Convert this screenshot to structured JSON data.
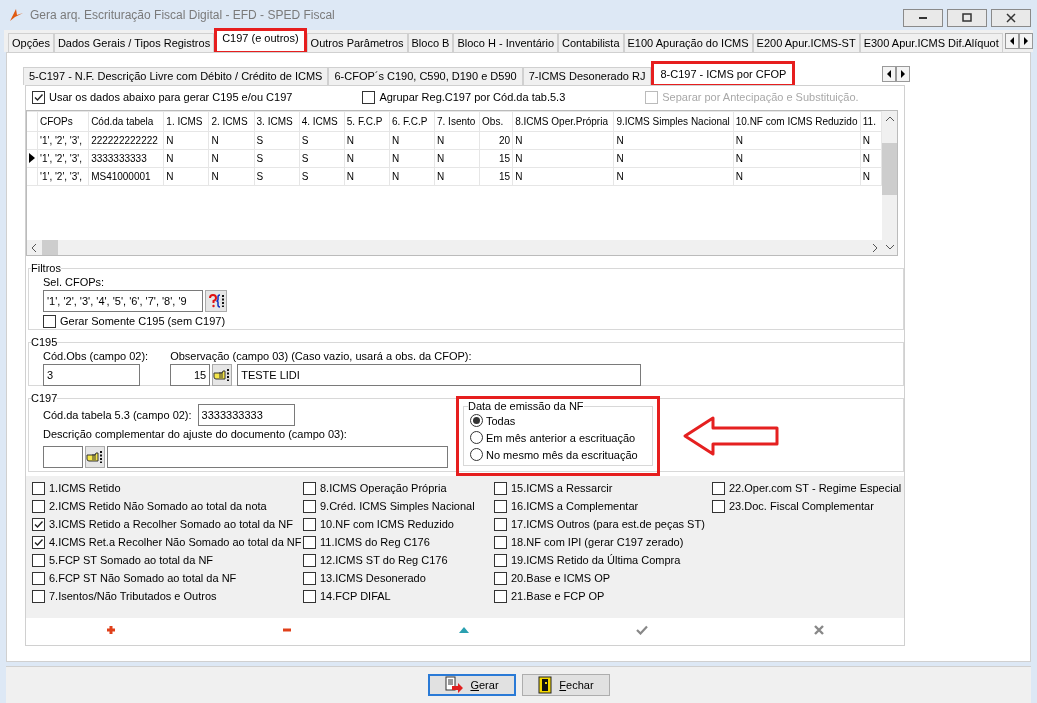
{
  "window": {
    "title": "Gera arq. Escrituração Fiscal Digital - EFD - SPED Fiscal"
  },
  "main_tabs": [
    {
      "label": "Opções",
      "selected": false,
      "highlighted": false
    },
    {
      "label": "Dados Gerais / Tipos Registros",
      "selected": false,
      "highlighted": false
    },
    {
      "label": "C197 (e outros)",
      "selected": true,
      "highlighted": true
    },
    {
      "label": "Outros Parâmetros",
      "selected": false,
      "highlighted": false
    },
    {
      "label": "Bloco B",
      "selected": false,
      "highlighted": false
    },
    {
      "label": "Bloco H - Inventário",
      "selected": false,
      "highlighted": false
    },
    {
      "label": "Contabilista",
      "selected": false,
      "highlighted": false
    },
    {
      "label": "E100 Apuração do ICMS",
      "selected": false,
      "highlighted": false
    },
    {
      "label": "E200 Apur.ICMS-ST",
      "selected": false,
      "highlighted": false
    },
    {
      "label": "E300 Apur.ICMS Dif.Alíquot",
      "selected": false,
      "highlighted": false
    }
  ],
  "sub_tabs": [
    {
      "label": "5-C197 - N.F. Descrição Livre com Débito / Crédito de ICMS",
      "selected": false,
      "highlighted": false
    },
    {
      "label": "6-CFOP´s C190, C590, D190 e D590",
      "selected": false,
      "highlighted": false
    },
    {
      "label": "7-ICMS Desonerado RJ",
      "selected": false,
      "highlighted": false
    },
    {
      "label": "8-C197 - ICMS por CFOP",
      "selected": true,
      "highlighted": true
    }
  ],
  "options": [
    {
      "label": "Usar os dados abaixo para gerar C195 e/ou C197",
      "checked": true,
      "disabled": false
    },
    {
      "label": "Agrupar Reg.C197 por Cód.da tab.5.3",
      "checked": false,
      "disabled": false
    },
    {
      "label": "Separar por Antecipação e Substituição.",
      "checked": false,
      "disabled": true
    }
  ],
  "grid": {
    "columns": [
      "CFOPs",
      "Cód.da tabela",
      "1. ICMS",
      "2. ICMS",
      "3. ICMS",
      "4. ICMS",
      "5. F.C.P",
      "6. F.C.P",
      "7. Isento",
      "Obs.",
      "8.ICMS Oper.Própria",
      "9.ICMS Simples Nacional",
      "10.NF com ICMS Reduzido",
      "11."
    ],
    "rows": [
      {
        "current": false,
        "cells": [
          "'1', '2', '3',",
          "222222222222",
          "N",
          "N",
          "S",
          "S",
          "N",
          "N",
          "N",
          "20",
          "N",
          "N",
          "N",
          "N"
        ]
      },
      {
        "current": true,
        "cells": [
          "'1', '2', '3',",
          "3333333333",
          "N",
          "N",
          "S",
          "S",
          "N",
          "N",
          "N",
          "15",
          "N",
          "N",
          "N",
          "N"
        ]
      },
      {
        "current": false,
        "cells": [
          "'1', '2', '3',",
          "MS41000001",
          "N",
          "N",
          "S",
          "S",
          "N",
          "N",
          "N",
          "15",
          "N",
          "N",
          "N",
          "N"
        ]
      }
    ]
  },
  "filtros": {
    "title": "Filtros",
    "cfops_label": "Sel. CFOPs:",
    "cfops_value": "'1', '2', '3', '4', '5', '6', '7', '8', '9",
    "only_c195": {
      "label": "Gerar Somente C195 (sem C197)",
      "checked": false
    }
  },
  "c195": {
    "title": "C195",
    "cod_obs_label": "Cód.Obs (campo 02):",
    "cod_obs_value": "3",
    "obs_label": "Observação (campo 03)  (Caso vazio, usará a obs. da CFOP):",
    "obs_code": "15",
    "obs_text": "TESTE LIDI"
  },
  "c197": {
    "title": "C197",
    "cod_label": "Cód.da tabela 5.3 (campo 02):",
    "cod_value": "3333333333",
    "desc_label": "Descrição complementar do ajuste do documento (campo 03):"
  },
  "date_group": {
    "title": "Data de emissão da NF",
    "highlighted": true,
    "options": [
      {
        "label": "Todas",
        "selected": true
      },
      {
        "label": "Em mês anterior a  escrituação",
        "selected": false
      },
      {
        "label": "No mesmo mês da escrituação",
        "selected": false
      }
    ]
  },
  "annotations": [
    {
      "kind": "arrow"
    }
  ],
  "flags": [
    [
      {
        "label": "1.ICMS Retido",
        "checked": false
      },
      {
        "label": "2.ICMS Retido Não Somado ao total da nota",
        "checked": false
      },
      {
        "label": "3.ICMS Retido a Recolher Somado ao total da NF",
        "checked": true
      },
      {
        "label": "4.ICMS Ret.a Recolher Não Somado ao total da NF",
        "checked": true
      },
      {
        "label": "5.FCP ST Somado ao total da NF",
        "checked": false
      },
      {
        "label": "6.FCP ST Não Somado ao total da NF",
        "checked": false
      },
      {
        "label": "7.Isentos/Não Tributados e Outros",
        "checked": false
      }
    ],
    [
      {
        "label": "8.ICMS Operação Própria",
        "checked": false
      },
      {
        "label": "9.Créd. ICMS Simples Nacional",
        "checked": false
      },
      {
        "label": "10.NF com ICMS Reduzido",
        "checked": false
      },
      {
        "label": "11.ICMS do Reg C176",
        "checked": false
      },
      {
        "label": "12.ICMS ST do Reg C176",
        "checked": false
      },
      {
        "label": "13.ICMS Desonerado",
        "checked": false
      },
      {
        "label": "14.FCP DIFAL",
        "checked": false
      }
    ],
    [
      {
        "label": "15.ICMS a Ressarcir",
        "checked": false
      },
      {
        "label": "16.ICMS a Complementar",
        "checked": false
      },
      {
        "label": "17.ICMS Outros (para est.de peças ST)",
        "checked": false
      },
      {
        "label": "18.NF com IPI (gerar C197 zerado)",
        "checked": false
      },
      {
        "label": "19.ICMS Retido da Última Compra",
        "checked": false
      },
      {
        "label": "20.Base e ICMS OP",
        "checked": false
      },
      {
        "label": "21.Base e FCP OP",
        "checked": false
      }
    ],
    [
      {
        "label": "22.Oper.com ST - Regime Especial",
        "checked": false
      },
      {
        "label": "23.Doc. Fiscal Complementar",
        "checked": false
      }
    ]
  ],
  "buttons": [
    {
      "label": "Gerar",
      "kind": "generate",
      "default": true
    },
    {
      "label": "Fechar",
      "kind": "close",
      "default": false
    }
  ]
}
